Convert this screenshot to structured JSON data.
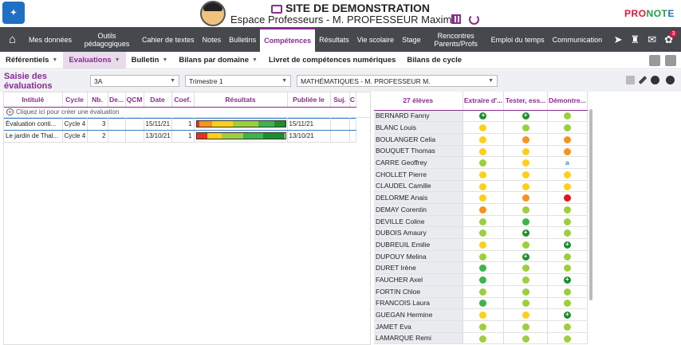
{
  "header": {
    "title": "SITE DE DEMONSTRATION",
    "subtitle": "Espace Professeurs - M. PROFESSEUR Maxime",
    "brand": "PRONOTE"
  },
  "menu": [
    "Mes données",
    "Outils pédagogiques",
    "Cahier de textes",
    "Notes",
    "Bulletins",
    "Compétences",
    "Résultats",
    "Vie scolaire",
    "Stage",
    "Rencontres Parents/Profs",
    "Emploi du temps",
    "Communication"
  ],
  "menu_active": "Compétences",
  "notif_count": "3",
  "submenu": [
    {
      "label": "Référentiels",
      "caret": true
    },
    {
      "label": "Evaluations",
      "caret": true,
      "active": true
    },
    {
      "label": "Bulletin",
      "caret": true
    },
    {
      "label": "Bilans par domaine",
      "caret": true
    },
    {
      "label": "Livret de compétences numériques",
      "caret": false
    },
    {
      "label": "Bilans de cycle",
      "caret": false
    }
  ],
  "filter": {
    "title": "Saisie des évaluations",
    "classe": "3A",
    "periode": "Trimestre 1",
    "matiere": "MATHÉMATIQUES - M. PROFESSEUR M."
  },
  "left_table": {
    "headers": [
      "Intitulé",
      "Cycle",
      "Nb.",
      "De...",
      "QCM",
      "Date",
      "Coef.",
      "Résultats",
      "Publiée le",
      "Suj.",
      "C"
    ],
    "create_label": "Cliquez ici pour créer une évaluation",
    "rows": [
      {
        "intitule": "Évaluation conti...",
        "cycle": "Cycle 4",
        "nb": "3",
        "date": "15/11/21",
        "coef": "1",
        "publiee": "15/11/21",
        "bar": [
          [
            "#e53222",
            3
          ],
          [
            "#f7931e",
            14
          ],
          [
            "#fdd017",
            22
          ],
          [
            "#9ccf3c",
            28
          ],
          [
            "#3cb54b",
            17
          ],
          [
            "#1a8f2a",
            12
          ]
        ]
      },
      {
        "intitule": "Le jardin de Thal...",
        "cycle": "Cycle 4",
        "nb": "2",
        "date": "13/10/21",
        "coef": "1",
        "publiee": "13/10/21",
        "bar": [
          [
            "#e53222",
            12
          ],
          [
            "#fdd017",
            16
          ],
          [
            "#9ccf3c",
            25
          ],
          [
            "#3cb54b",
            22
          ],
          [
            "#1a8f2a",
            25
          ]
        ]
      }
    ]
  },
  "students_table": {
    "count_label": "27 élèves",
    "headers": [
      "Extraire d'...",
      "Tester, ess...",
      "Démontre..."
    ],
    "colors": {
      "r": "#e0161c",
      "o": "#f7931e",
      "y": "#fdd017",
      "l": "#9ccf3c",
      "g": "#3cb54b",
      "d": "#1a8f2a"
    },
    "rows": [
      [
        "BERNARD Fanny",
        "D",
        "D",
        "l"
      ],
      [
        "BLANC Louis",
        "y",
        "l",
        "l"
      ],
      [
        "BOULANGER Celia",
        "y",
        "o",
        "o"
      ],
      [
        "BOUQUET Thomas",
        "y",
        "y",
        "o"
      ],
      [
        "CARRE Geoffrey",
        "l",
        "y",
        "a"
      ],
      [
        "CHOLLET Pierre",
        "y",
        "y",
        "y"
      ],
      [
        "CLAUDEL Camille",
        "y",
        "y",
        "y"
      ],
      [
        "DELORME Anais",
        "y",
        "o",
        "r"
      ],
      [
        "DEMAY Corentin",
        "o",
        "l",
        "l"
      ],
      [
        "DEVILLE Coline",
        "l",
        "g",
        "l"
      ],
      [
        "DUBOIS Amaury",
        "l",
        "D",
        "l"
      ],
      [
        "DUBREUIL Emilie",
        "y",
        "l",
        "D"
      ],
      [
        "DUPOUY Melina",
        "l",
        "D",
        "l"
      ],
      [
        "DURET Irène",
        "g",
        "l",
        "l"
      ],
      [
        "FAUCHER Axel",
        "g",
        "l",
        "D"
      ],
      [
        "FORTIN Chloe",
        "l",
        "l",
        "l"
      ],
      [
        "FRANCOIS Laura",
        "g",
        "l",
        "l"
      ],
      [
        "GUEGAN Hermine",
        "y",
        "y",
        "D"
      ],
      [
        "JAMET Eva",
        "l",
        "l",
        "l"
      ],
      [
        "LAMARQUE Remi",
        "l",
        "l",
        "l"
      ]
    ]
  }
}
